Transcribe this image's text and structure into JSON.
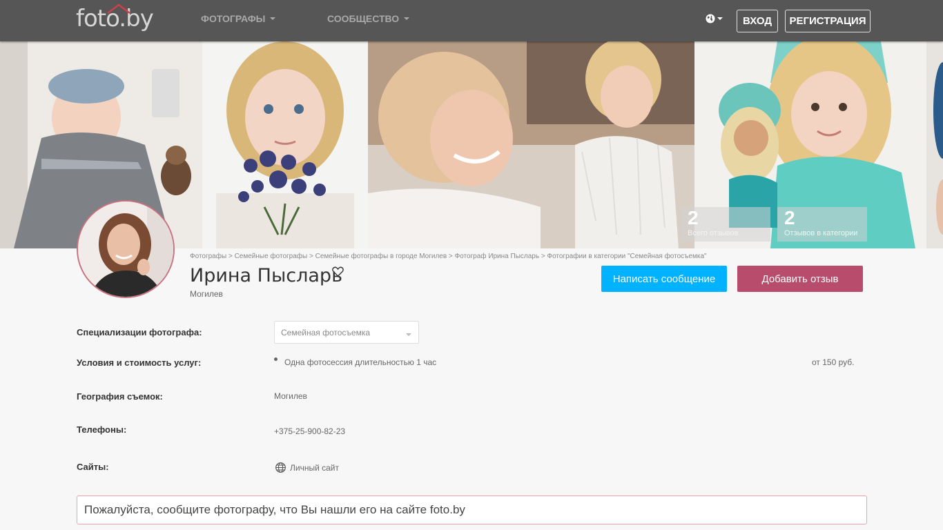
{
  "navbar": {
    "logo_text": "foto.by",
    "menu": [
      {
        "label": "ФОТОГРАФЫ"
      },
      {
        "label": "СООБЩЕСТВО"
      }
    ],
    "language_icon": "globe-icon",
    "login_label": "ВХОД",
    "register_label": "РЕГИСТРАЦИЯ"
  },
  "stats": [
    {
      "number": "2",
      "label": "Всего отзывов"
    },
    {
      "number": "2",
      "label": "Отзывов в категории"
    }
  ],
  "breadcrumb": [
    "Фотографы",
    "Семейные фотографы",
    "Семейные фотографы в городе Могилев",
    "Фотограф Ирина Пысларь",
    "Фотографии в категории \"Семейная фотосъемка\""
  ],
  "breadcrumb_separator": " > ",
  "profile": {
    "name": "Ирина Пысларь",
    "city": "Могилев",
    "message_button": "Написать сообщение",
    "review_button": "Добавить отзыв"
  },
  "details": {
    "specialization_label": "Специализации фотографа:",
    "specialization_value": "Семейная фотосъемка",
    "services_label": "Условия и стоимость услуг:",
    "service_name": "Одна фотосессия длительностью 1 час",
    "service_price": "от 150 руб.",
    "geo_label": "География съемок:",
    "geo_value": "Могилев",
    "phones_label": "Телефоны:",
    "phone_value": "+375-25-900-82-23",
    "sites_label": "Сайты:",
    "site_value": "Личный сайт"
  },
  "notice": "Пожалуйста, сообщите фотографу, что Вы нашли его на сайте foto.by",
  "colors": {
    "navbar": "#565656",
    "message_button": "#00b2ff",
    "review_button": "#b84c6c",
    "notice_border": "#e8a3ad"
  }
}
